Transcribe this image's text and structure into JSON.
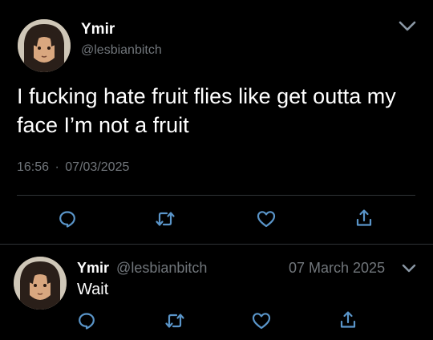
{
  "main_tweet": {
    "author": {
      "display_name": "Ymir",
      "handle": "@lesbianbitch"
    },
    "text": "I fucking hate fruit flies like get outta my face I’m not a fruit",
    "time": "16:56",
    "separator": "·",
    "date": "07/03/2025",
    "actions": [
      "reply-icon",
      "retweet-icon",
      "like-icon",
      "share-icon"
    ],
    "menu_icon": "chevron-down-icon"
  },
  "reply_tweet": {
    "author": {
      "display_name": "Ymir",
      "handle": "@lesbianbitch"
    },
    "date": "07 March 2025",
    "text": "Wait",
    "actions": [
      "reply-icon",
      "retweet-icon",
      "like-icon",
      "share-icon"
    ],
    "menu_icon": "chevron-down-icon"
  },
  "colors": {
    "background": "#000000",
    "text": "#e7e9ea",
    "muted": "#71767b",
    "divider": "#2f3336"
  }
}
